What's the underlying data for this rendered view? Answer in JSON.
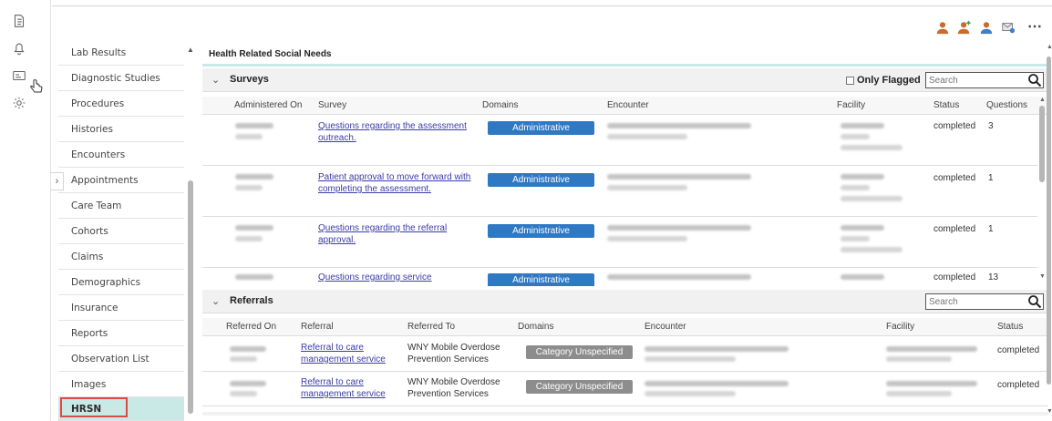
{
  "rail": {
    "icons": [
      "document-icon",
      "bell-icon",
      "card-icon",
      "gear-icon"
    ]
  },
  "nav": {
    "items": [
      {
        "label": "Lab Results"
      },
      {
        "label": "Diagnostic Studies"
      },
      {
        "label": "Procedures"
      },
      {
        "label": "Histories"
      },
      {
        "label": "Encounters"
      },
      {
        "label": "Appointments"
      },
      {
        "label": "Care Team"
      },
      {
        "label": "Cohorts"
      },
      {
        "label": "Claims"
      },
      {
        "label": "Demographics"
      },
      {
        "label": "Insurance"
      },
      {
        "label": "Reports"
      },
      {
        "label": "Observation List"
      },
      {
        "label": "Images"
      },
      {
        "label": "HRSN"
      }
    ],
    "active": "HRSN"
  },
  "main": {
    "title": "Health Related Social Needs"
  },
  "surveys": {
    "title": "Surveys",
    "only_flagged": "Only Flagged",
    "search_placeholder": "Search",
    "columns": [
      "Administered On",
      "Survey",
      "Domains",
      "Encounter",
      "Facility",
      "Status",
      "Questions"
    ],
    "rows": [
      {
        "survey": "Questions regarding the assessment outreach.",
        "domain": "Administrative",
        "status": "completed",
        "questions": "3"
      },
      {
        "survey": "Patient approval to move forward with completing the assessment.",
        "domain": "Administrative",
        "status": "completed",
        "questions": "1"
      },
      {
        "survey": "Questions regarding the referral approval.",
        "domain": "Administrative",
        "status": "completed",
        "questions": "1"
      },
      {
        "survey": "Questions regarding service",
        "domain": "Administrative",
        "status": "completed",
        "questions": "13"
      }
    ]
  },
  "referrals": {
    "title": "Referrals",
    "search_placeholder": "Search",
    "columns": [
      "Referred On",
      "Referral",
      "Referred To",
      "Domains",
      "Encounter",
      "Facility",
      "Status"
    ],
    "rows": [
      {
        "referral": "Referral to care management service",
        "referred_to": "WNY Mobile Overdose Prevention Services",
        "domain": "Category Unspecified",
        "status": "completed"
      },
      {
        "referral": "Referral to care management service",
        "referred_to": "WNY Mobile Overdose Prevention Services",
        "domain": "Category Unspecified",
        "status": "completed"
      }
    ]
  },
  "colors": {
    "accent": "#c9e9e7",
    "badge_admin": "#2f78c4",
    "badge_category": "#8d8d8d",
    "highlight": "#e04848",
    "link": "#3b3ba8"
  }
}
